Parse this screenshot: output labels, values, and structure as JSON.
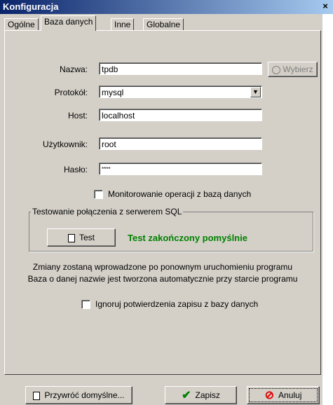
{
  "window": {
    "title": "Konfiguracja",
    "close_label": "×"
  },
  "tabs": [
    "Ogólne",
    "Baza danych",
    "Inne",
    "Globalne"
  ],
  "form": {
    "name_label": "Nazwa:",
    "name_value": "tpdb",
    "select_button": "Wybierz",
    "protocol_label": "Protokół:",
    "protocol_value": "mysql",
    "host_label": "Host:",
    "host_value": "localhost",
    "user_label": "Użytkownik:",
    "user_value": "root",
    "password_label": "Hasło:",
    "password_value": "****",
    "monitor_label": "Monitorowanie operacji z bazą danych"
  },
  "test_group": {
    "title": "Testowanie połączenia z serwerem SQL",
    "test_button": "Test",
    "result": "Test zakończony pomyślnie",
    "result_color": "#008000"
  },
  "info": {
    "line1": "Zmiany zostaną wprowadzone po ponownym uruchomieniu programu",
    "line2": "Baza o danej nazwie jest tworzona automatycznie przy starcie programu"
  },
  "ignore_label": "Ignoruj potwierdzenia zapisu z bazy danych",
  "footer": {
    "restore": "Przywróć domyślne...",
    "save": "Zapisz",
    "cancel": "Anuluj"
  }
}
